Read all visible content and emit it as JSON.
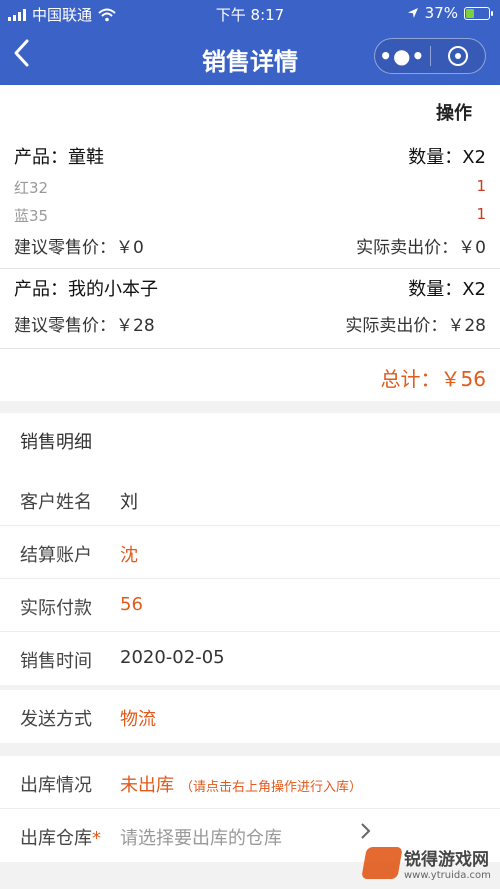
{
  "status_bar": {
    "carrier": "中国联通",
    "time": "下午 8:17",
    "battery": "37%"
  },
  "nav": {
    "title": "销售详情"
  },
  "op_bar": {
    "label": "操作"
  },
  "products": [
    {
      "name": "产品：童鞋",
      "qty": "数量：X2",
      "variants": [
        {
          "label": "红32",
          "qty": "1"
        },
        {
          "label": "蓝35",
          "qty": "1"
        }
      ],
      "suggested": "建议零售价：￥0",
      "actual": "实际卖出价：￥0"
    },
    {
      "name": "产品：我的小本子",
      "qty": "数量：X2",
      "variants": [],
      "suggested": "建议零售价：￥28",
      "actual": "实际卖出价：￥28"
    }
  ],
  "total": "总计：￥56",
  "detail": {
    "title": "销售明细",
    "rows": [
      {
        "label": "客户姓名",
        "value": "刘"
      },
      {
        "label": "结算账户",
        "value": "沈"
      },
      {
        "label": "实际付款",
        "value": "56"
      },
      {
        "label": "销售时间",
        "value": "2020-02-05"
      }
    ]
  },
  "shipping": {
    "label": "发送方式",
    "value": "物流"
  },
  "stock": {
    "status_label": "出库情况",
    "status_value": "未出库",
    "status_hint": "（请点击右上角操作进行入库）",
    "warehouse_label": "出库仓库",
    "warehouse_required": "*",
    "warehouse_placeholder": "请选择要出库的仓库"
  },
  "watermark": {
    "name": "锐得游戏网",
    "url": "www.ytruida.com"
  },
  "colors": {
    "nav_blue": "#3b62c6",
    "accent_orange": "#e25a1c"
  },
  "icons": [
    "signal-icon",
    "wifi-icon",
    "location-arrow-icon",
    "battery-icon",
    "back-chevron-icon",
    "more-dots-icon",
    "close-circle-icon",
    "chevron-right-icon"
  ]
}
